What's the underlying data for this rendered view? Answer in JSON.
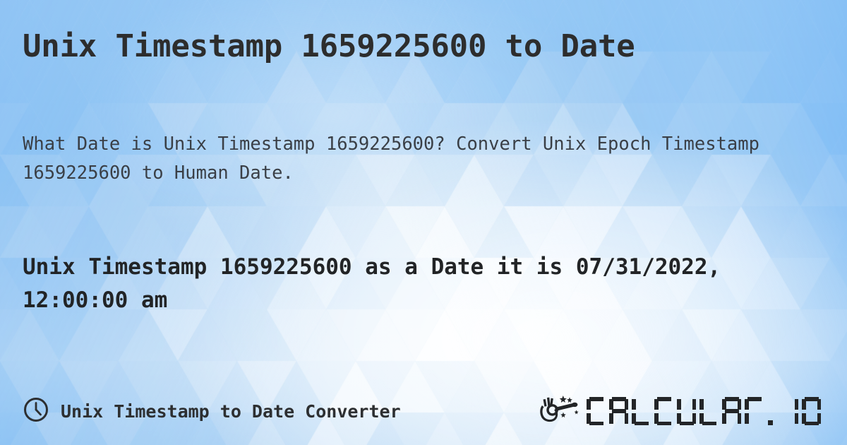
{
  "page": {
    "title": "Unix Timestamp 1659225600 to Date",
    "description": "What Date is Unix Timestamp 1659225600? Convert Unix Epoch Timestamp 1659225600 to Human Date.",
    "result": "Unix Timestamp 1659225600 as a Date it is 07/31/2022, 12:00:00 am"
  },
  "values": {
    "timestamp": "1659225600",
    "date": "07/31/2022",
    "time": "12:00:00 am"
  },
  "footer": {
    "clock_icon": "clock-icon",
    "label": "Unix Timestamp to Date Converter",
    "brand": {
      "wand_icon": "magic-wand-hand-icon",
      "name": "CALCULAT.IO",
      "letters": [
        "C",
        "A",
        "L",
        "C",
        "U",
        "L",
        "A",
        "T",
        ".",
        "I",
        "O"
      ]
    }
  },
  "colors": {
    "background_blue": "#b3d6f5",
    "background_light": "#eaf4fd",
    "background_deep": "#8cc4f5",
    "text_dark": "#2d2d2d",
    "text_body": "#3a3f46",
    "brand_dark": "#232527"
  }
}
